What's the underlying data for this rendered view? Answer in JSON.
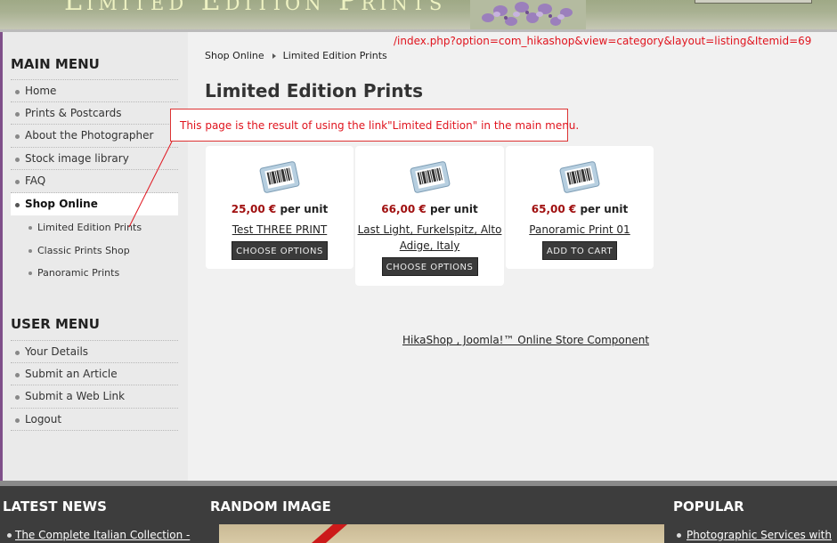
{
  "header": {
    "site_title": "Limited Edition Prints"
  },
  "annotation": {
    "url": "/index.php?option=com_hikashop&view=category&layout=listing&Itemid=69",
    "callout": "This page is the result of using the link\"Limited Edition\" in the main menu."
  },
  "main_menu": {
    "title": "MAIN MENU",
    "items": [
      {
        "label": "Home"
      },
      {
        "label": "Prints & Postcards"
      },
      {
        "label": "About the Photographer"
      },
      {
        "label": "Stock image library"
      },
      {
        "label": "FAQ"
      },
      {
        "label": "Shop Online"
      }
    ],
    "submenu": [
      {
        "label": "Limited Edition Prints"
      },
      {
        "label": "Classic Prints Shop"
      },
      {
        "label": "Panoramic Prints"
      }
    ]
  },
  "user_menu": {
    "title": "USER MENU",
    "items": [
      {
        "label": "Your Details"
      },
      {
        "label": "Submit an Article"
      },
      {
        "label": "Submit a Web Link"
      },
      {
        "label": "Logout"
      }
    ]
  },
  "breadcrumb": {
    "items": [
      "Shop Online",
      "Limited Edition Prints"
    ]
  },
  "page_title": "Limited Edition Prints",
  "products": [
    {
      "price": "25,00 €",
      "unit": " per unit",
      "name_line1": "Test THREE PRINT",
      "name_line2": "",
      "button": "CHOOSE OPTIONS"
    },
    {
      "price": "66,00 €",
      "unit": " per unit",
      "name_line1": "Last Light, Furkelspitz, Alto",
      "name_line2": "Adige, Italy",
      "button": "CHOOSE OPTIONS"
    },
    {
      "price": "65,00 €",
      "unit": " per unit",
      "name_line1": "Panoramic Print 01",
      "name_line2": "",
      "button": "ADD TO CART"
    }
  ],
  "footer_link": "HikaShop , Joomla!™ Online Store Component",
  "bottom": {
    "latest_news": {
      "title": "LATEST NEWS",
      "link": "The Complete Italian Collection -"
    },
    "random_image": {
      "title": "RANDOM IMAGE"
    },
    "popular": {
      "title": "POPULAR",
      "link": "Photographic Services with"
    }
  },
  "colors": {
    "annotation_red": "#e0141e",
    "price_red": "#a01010",
    "sidebar_bg": "#eaeaea",
    "main_bg": "#f1f1f1",
    "bottom_bg": "#3d3d3d"
  },
  "icons": {
    "product_thumb": "barcode-icon",
    "menu_bullet": "bullet-icon",
    "breadcrumb_separator": "triangle-right-icon"
  }
}
